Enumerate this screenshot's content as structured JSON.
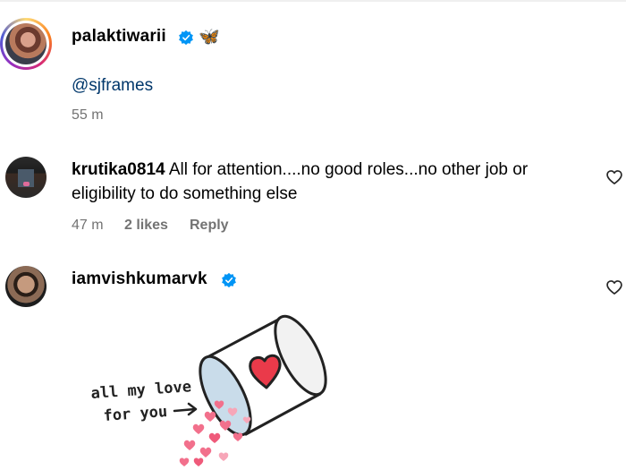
{
  "post": {
    "username": "palaktiwarii",
    "emoji": "🦋",
    "mention": "@sjframes",
    "time": "55 m"
  },
  "comments": [
    {
      "username": "krutika0814",
      "text": "All for attention....no good roles...no other job or eligibility to do something else",
      "time": "47 m",
      "likes": "2 likes",
      "reply": "Reply"
    },
    {
      "username": "iamvishkumarvk",
      "sticker_text_line1": "all my love",
      "sticker_text_line2": "for you"
    }
  ],
  "colors": {
    "verified": "#0095f6",
    "mention": "#00376b",
    "muted": "#737373",
    "heart": "#ed4956"
  }
}
